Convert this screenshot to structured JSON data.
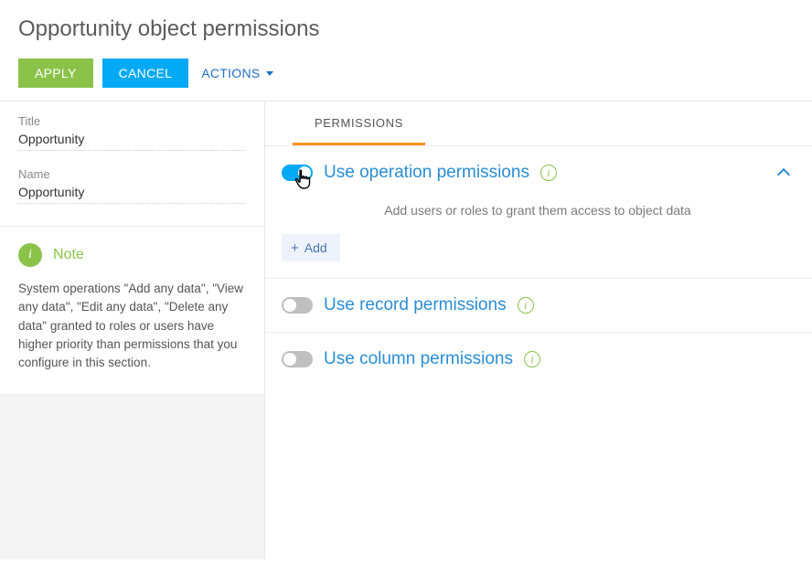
{
  "header": {
    "title": "Opportunity object permissions",
    "apply_label": "APPLY",
    "cancel_label": "CANCEL",
    "actions_label": "ACTIONS"
  },
  "form": {
    "title_label": "Title",
    "title_value": "Opportunity",
    "name_label": "Name",
    "name_value": "Opportunity"
  },
  "note": {
    "badge": "i",
    "heading": "Note",
    "text": "System operations \"Add any data\", \"View any data\", \"Edit any data\", \"Delete any data\" granted to roles or users have higher priority than permissions that you configure in this section."
  },
  "tabs": {
    "permissions": "PERMISSIONS"
  },
  "permissions": {
    "operation": {
      "title": "Use operation permissions",
      "help": "Add users or roles to grant them access to object data",
      "add_label": "Add"
    },
    "record": {
      "title": "Use record permissions"
    },
    "column": {
      "title": "Use column permissions"
    }
  },
  "info_glyph": "i"
}
